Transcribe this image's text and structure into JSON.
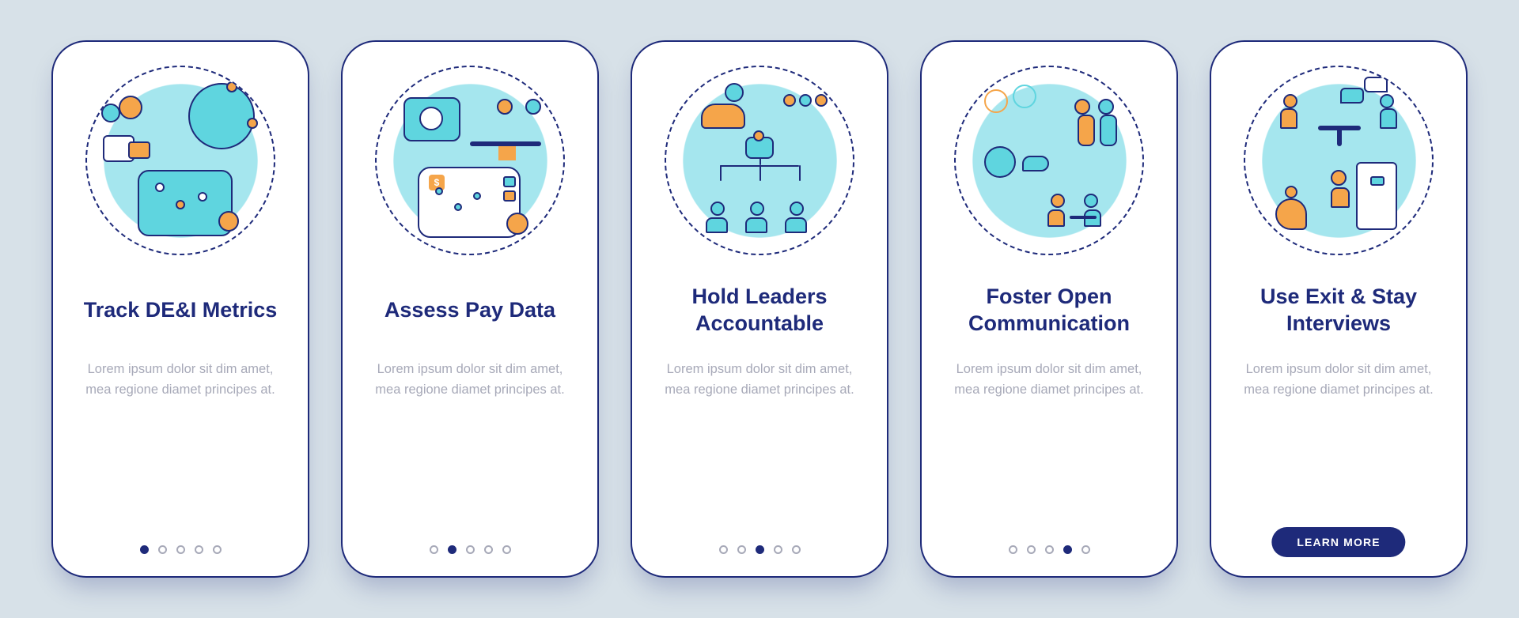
{
  "colors": {
    "primary": "#1e2a7a",
    "accent_warm": "#f5a54a",
    "accent_cool": "#5fd5df",
    "muted": "#a7a9b8",
    "canvas": "#d7e1e8"
  },
  "shared_body_text": "Lorem ipsum dolor sit dim amet, mea regione diamet principes at.",
  "cta_label": "LEARN MORE",
  "total_steps": 5,
  "cards": [
    {
      "title": "Track DE&I Metrics",
      "body_key": "shared_body_text",
      "active_step": 0,
      "illustration": "metrics-icon",
      "has_cta": false
    },
    {
      "title": "Assess Pay Data",
      "body_key": "shared_body_text",
      "active_step": 1,
      "illustration": "pay-data-icon",
      "has_cta": false
    },
    {
      "title": "Hold Leaders Accountable",
      "body_key": "shared_body_text",
      "active_step": 2,
      "illustration": "accountability-icon",
      "has_cta": false
    },
    {
      "title": "Foster Open Communication",
      "body_key": "shared_body_text",
      "active_step": 3,
      "illustration": "communication-icon",
      "has_cta": false
    },
    {
      "title": "Use Exit & Stay Interviews",
      "body_key": "shared_body_text",
      "active_step": 4,
      "illustration": "interviews-icon",
      "has_cta": true
    }
  ]
}
